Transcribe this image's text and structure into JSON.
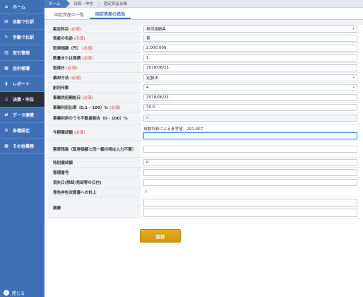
{
  "sidebar": {
    "items": [
      {
        "label": "ホーム",
        "icon": "home-icon",
        "glyph": "⌂"
      },
      {
        "label": "自動で仕訳",
        "icon": "auto-journal-icon",
        "glyph": "▤"
      },
      {
        "label": "手動で仕訳",
        "icon": "manual-journal-icon",
        "glyph": "✎"
      },
      {
        "label": "取引管理",
        "icon": "transactions-icon",
        "glyph": "▥"
      },
      {
        "label": "会計帳簿",
        "icon": "ledger-icon",
        "glyph": "▦"
      },
      {
        "label": "レポート",
        "icon": "report-icon",
        "glyph": "▮"
      },
      {
        "label": "決算・申告",
        "icon": "settlement-icon",
        "glyph": "▯"
      },
      {
        "label": "データ連携",
        "icon": "data-link-icon",
        "glyph": "⇄"
      },
      {
        "label": "各種設定",
        "icon": "settings-icon",
        "glyph": "⚙"
      },
      {
        "label": "その他業務",
        "icon": "other-tasks-icon",
        "glyph": "▦"
      }
    ],
    "close_label": "閉じる"
  },
  "breadcrumb": [
    "ホーム",
    "決算・申告",
    "固定資産台帳"
  ],
  "tabs": [
    "固定資産の一覧",
    "固定資産の追加"
  ],
  "form": {
    "required_mark": "(必須)",
    "rows": [
      {
        "label": "勘定科目",
        "required": true,
        "type": "select",
        "value": "車両運搬具"
      },
      {
        "label": "資産の名前",
        "required": true,
        "type": "text",
        "value": "車"
      },
      {
        "label": "取得価額（円）",
        "required": true,
        "type": "text",
        "value": "2,000,000"
      },
      {
        "label": "数量または面積",
        "required": true,
        "type": "text",
        "value": "1"
      },
      {
        "label": "取得日",
        "required": true,
        "type": "text",
        "value": "2018/06/21"
      },
      {
        "label": "償却方法",
        "required": true,
        "type": "select",
        "value": "定額法"
      },
      {
        "label": "耐用年数",
        "required": false,
        "type": "select",
        "value": "4"
      },
      {
        "label": "事業供用開始日",
        "required": true,
        "type": "text",
        "value": "2018/06/21"
      },
      {
        "label": "事業利用比率（0.1 - 100）%",
        "required": true,
        "type": "text",
        "value": "70.0"
      },
      {
        "label": "事業利用のうち不動産割合（0 - 100）%",
        "required": false,
        "type": "disabled",
        "value": "0"
      },
      {
        "label": "今期償却額",
        "required": true,
        "type": "note-text",
        "note": "自動計算による参考値：291,667",
        "value": ""
      },
      {
        "label": "期首残高（取得価額と同一額の時は入力不要）",
        "required": false,
        "type": "text",
        "value": ""
      },
      {
        "label": "特別償却額",
        "required": false,
        "type": "text",
        "value": "0"
      },
      {
        "label": "管理番号",
        "required": false,
        "type": "text",
        "value": ""
      },
      {
        "label": "消失日(除却/売却等の日付)",
        "required": false,
        "type": "text",
        "value": ""
      },
      {
        "label": "青色申告決算書への計上",
        "required": false,
        "type": "checkbox",
        "value": "✓"
      },
      {
        "label": "摘要",
        "required": false,
        "type": "textarea",
        "value": ""
      }
    ]
  },
  "save_label": "保存",
  "colors": {
    "sidebar": "#3f6fb4",
    "active": "#2b2f3a",
    "required": "#d43d3d",
    "save": "#d9a116"
  }
}
